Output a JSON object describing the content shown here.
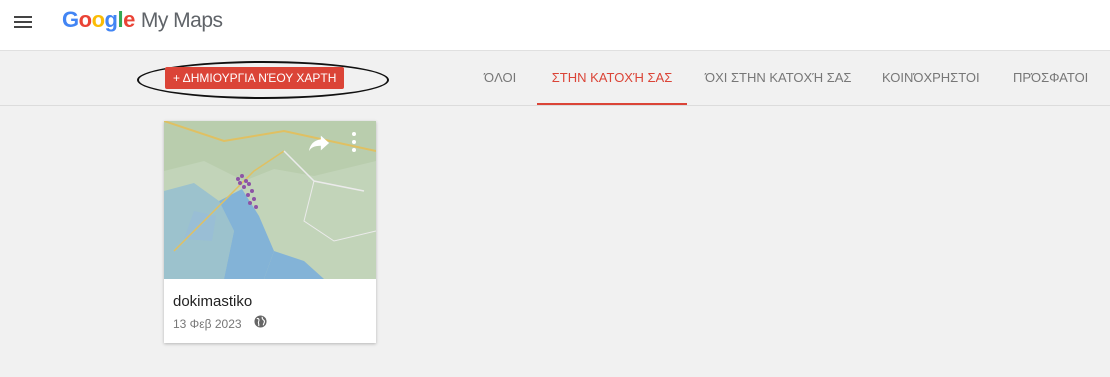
{
  "header": {
    "logo_google": "Google",
    "logo_product": "My Maps"
  },
  "toolbar": {
    "create_label": "+ ΔΗΜΙΟΥΡΓΙΑ ΝΈΟΥ ΧΑΡΤΗ",
    "tabs": [
      {
        "label": "ΌΛΟΙ"
      },
      {
        "label": "ΣΤΗΝ ΚΑΤΟΧΉ ΣΑΣ"
      },
      {
        "label": "ΌΧΙ ΣΤΗΝ ΚΑΤΟΧΉ ΣΑΣ"
      },
      {
        "label": "ΚΟΙΝΌΧΡΗΣΤΟΙ"
      },
      {
        "label": "ΠΡΌΣΦΑΤΟΙ"
      }
    ],
    "active_tab": "ΣΤΗΝ ΚΑΤΟΧΉ ΣΑΣ"
  },
  "maps": [
    {
      "title": "dokimastiko",
      "date": "13 Φεβ 2023",
      "visibility_icon": "globe-icon"
    }
  ],
  "colors": {
    "accent": "#db4437",
    "background": "#f1f1f1"
  }
}
